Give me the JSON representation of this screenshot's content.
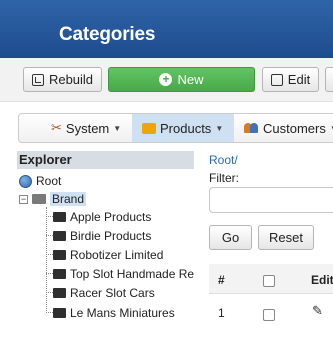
{
  "header": {
    "title": "Categories"
  },
  "toolbar": {
    "rebuild_label": "Rebuild",
    "new_label": "New",
    "edit_label": "Edit",
    "new_color": "#49a949"
  },
  "menu": {
    "system_label": "System",
    "products_label": "Products",
    "customers_label": "Customers"
  },
  "explorer": {
    "title": "Explorer",
    "root_label": "Root",
    "brand_label": "Brand",
    "children": [
      "Apple Products",
      "Birdie Products",
      "Robotizer Limited",
      "Top Slot Handmade Re",
      "Racer Slot Cars",
      "Le Mans Miniatures"
    ]
  },
  "panel": {
    "breadcrumb": "Root/",
    "filter_label": "Filter:",
    "filter_value": "",
    "go_label": "Go",
    "reset_label": "Reset"
  },
  "table": {
    "headers": {
      "num": "#",
      "edit": "Edit"
    },
    "rows": [
      {
        "num": "1"
      }
    ]
  }
}
